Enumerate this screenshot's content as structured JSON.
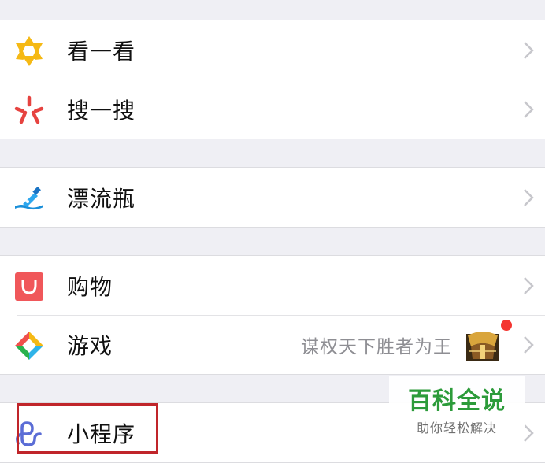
{
  "menu": {
    "look": {
      "label": "看一看",
      "icon": "look-icon"
    },
    "search": {
      "label": "搜一搜",
      "icon": "search-icon"
    },
    "bottle": {
      "label": "漂流瓶",
      "icon": "drift-bottle-icon"
    },
    "shopping": {
      "label": "购物",
      "icon": "shopping-bag-icon"
    },
    "games": {
      "label": "游戏",
      "note": "谋权天下胜者为王",
      "icon": "games-icon"
    },
    "mini_programs": {
      "label": "小程序",
      "icon": "mini-program-icon"
    }
  },
  "watermark": {
    "title": "百科全说",
    "subtitle": "助你轻松解决"
  },
  "colors": {
    "background": "#efeff4",
    "highlight": "#c0252a",
    "badge": "#f43530",
    "watermark_green": "#2c9b3a"
  }
}
